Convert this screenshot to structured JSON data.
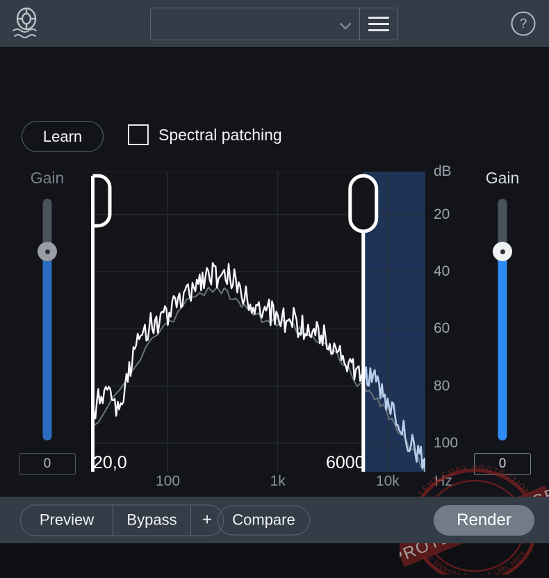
{
  "app": {
    "logo_icon": "lifebuoy-waves-icon",
    "background": "#121419",
    "panel_color": "#343c47"
  },
  "header": {
    "preset": {
      "value": "",
      "placeholder": "",
      "chevron_icon": "chevron-down-icon"
    },
    "menu_icon": "hamburger-menu-icon",
    "help_icon": "question-mark-circle-icon"
  },
  "controls": {
    "learn_label": "Learn",
    "spectral_patching_label": "Spectral patching",
    "spectral_patching_checked": false,
    "checkbox_icon": "checkbox-unchecked-icon"
  },
  "input_gain": {
    "label": "Gain",
    "value": "0",
    "fill_color": "#2b6cc0",
    "thumb_color": "#9a9ea4",
    "position_percent": 78
  },
  "output_gain": {
    "label": "Gain",
    "value": "0",
    "fill_color": "#2f8bf5",
    "thumb_color": "#f0f1f3",
    "position_percent": 78
  },
  "graph": {
    "left_handle_label": "20,0",
    "right_handle_label": "6000",
    "selection_color": "#1e3356",
    "curve_color": "#f5f7fa",
    "peak_color": "#6e7479",
    "selected_curve_color": "#b6cdec"
  },
  "footer": {
    "preview_label": "Preview",
    "bypass_label": "Bypass",
    "plus_label": "+",
    "compare_label": "Compare",
    "render_label": "Render"
  },
  "watermark": {
    "main_text": "PROTECTED IMAGE",
    "ring_top_text": "WP CONTENT COPY PROTECTION PLUGIN",
    "ring_bottom_text": "My Website Name & URL Here",
    "color": "#8b2222"
  },
  "chart_data": {
    "type": "line",
    "title": "",
    "xlabel": "Hz",
    "ylabel": "dB",
    "xscale": "log",
    "xlim": [
      20,
      22000
    ],
    "ylim": [
      -110,
      -5
    ],
    "grid": true,
    "x_ticks": [
      "100",
      "1k",
      "10k"
    ],
    "x_tick_values": [
      100,
      1000,
      10000
    ],
    "y_ticks": [
      "dB",
      "20",
      "40",
      "60",
      "80",
      "100"
    ],
    "y_tick_values": [
      -5,
      -20,
      -40,
      -60,
      -80,
      -100
    ],
    "selection": {
      "low_hz": 20.0,
      "high_hz": 6000,
      "label_low": "20,0",
      "label_high": "6000"
    },
    "series": [
      {
        "name": "spectrum",
        "color": "#f5f7fa",
        "x": [
          20,
          24,
          29,
          35,
          42,
          50,
          60,
          72,
          86,
          103,
          124,
          148,
          178,
          213,
          256,
          307,
          368,
          441,
          529,
          635,
          761,
          913,
          1095,
          1314,
          1576,
          1890,
          2267,
          2719,
          3261,
          3911,
          4691,
          5626,
          6748,
          8093,
          9706,
          11641,
          13962,
          16745,
          20085,
          22000
        ],
        "y": [
          -92,
          -83,
          -79,
          -88,
          -78,
          -68,
          -62,
          -58,
          -57,
          -54,
          -51,
          -48,
          -44,
          -42,
          -40,
          -44,
          -41,
          -46,
          -49,
          -52,
          -53,
          -55,
          -57,
          -56,
          -59,
          -60,
          -62,
          -63,
          -66,
          -70,
          -74,
          -78,
          -76,
          -80,
          -86,
          -90,
          -96,
          -101,
          -104,
          -110
        ]
      },
      {
        "name": "peak-hold",
        "color": "#6e7479",
        "x": [
          20,
          50,
          103,
          178,
          307,
          441,
          635,
          913,
          1314,
          1890,
          2719,
          3911,
          5626,
          8093,
          11641,
          16745,
          22000
        ],
        "y": [
          -96,
          -72,
          -58,
          -48,
          -46,
          -50,
          -55,
          -58,
          -59,
          -63,
          -66,
          -72,
          -80,
          -84,
          -94,
          -103,
          -110
        ]
      }
    ]
  }
}
